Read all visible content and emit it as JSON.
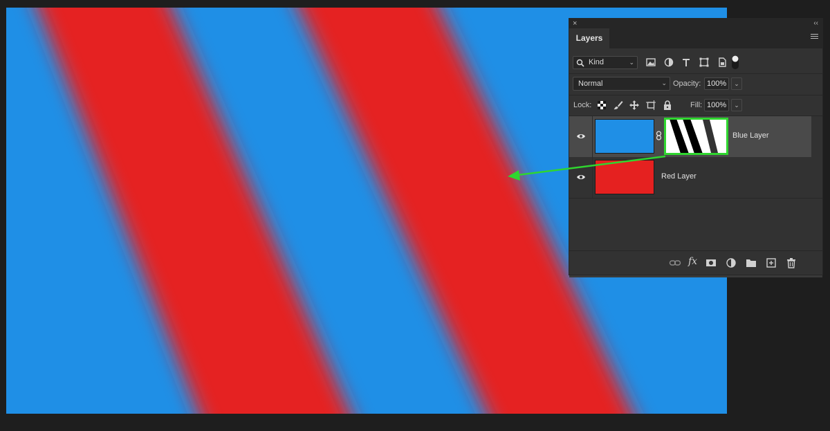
{
  "canvas": {
    "background_color": "#1f8fe6",
    "stripe_color": "#e52120"
  },
  "panel": {
    "close_glyph": "×",
    "collapse_glyph": "‹‹",
    "tab_label": "Layers",
    "menu_icon": "panel-menu-icon",
    "filter": {
      "kind_label": "Kind",
      "icons": [
        "search-icon",
        "image-filter-icon",
        "adjustment-filter-icon",
        "type-filter-icon",
        "shape-filter-icon",
        "smart-object-filter-icon",
        "filter-toggle-icon"
      ]
    },
    "blend_mode": "Normal",
    "opacity_label": "Opacity:",
    "opacity_value": "100%",
    "lock_label": "Lock:",
    "lock_icons": [
      "lock-transparent-pixels-icon",
      "lock-image-pixels-icon",
      "lock-position-icon",
      "lock-artboard-icon",
      "lock-all-icon"
    ],
    "fill_label": "Fill:",
    "fill_value": "100%",
    "layers": [
      {
        "name": "Blue Layer",
        "thumb_color": "#1f8fe6",
        "has_mask": true,
        "visible": true,
        "selected": true
      },
      {
        "name": "Red Layer",
        "thumb_color": "#e52120",
        "has_mask": false,
        "visible": true,
        "selected": false
      }
    ],
    "bottom_icons": [
      "link-layers-icon",
      "fx-icon",
      "add-mask-icon",
      "new-adjustment-layer-icon",
      "new-group-icon",
      "new-layer-icon",
      "delete-icon"
    ],
    "fx_label": "fx"
  },
  "annotation": {
    "highlight_color": "#2fd62f"
  }
}
